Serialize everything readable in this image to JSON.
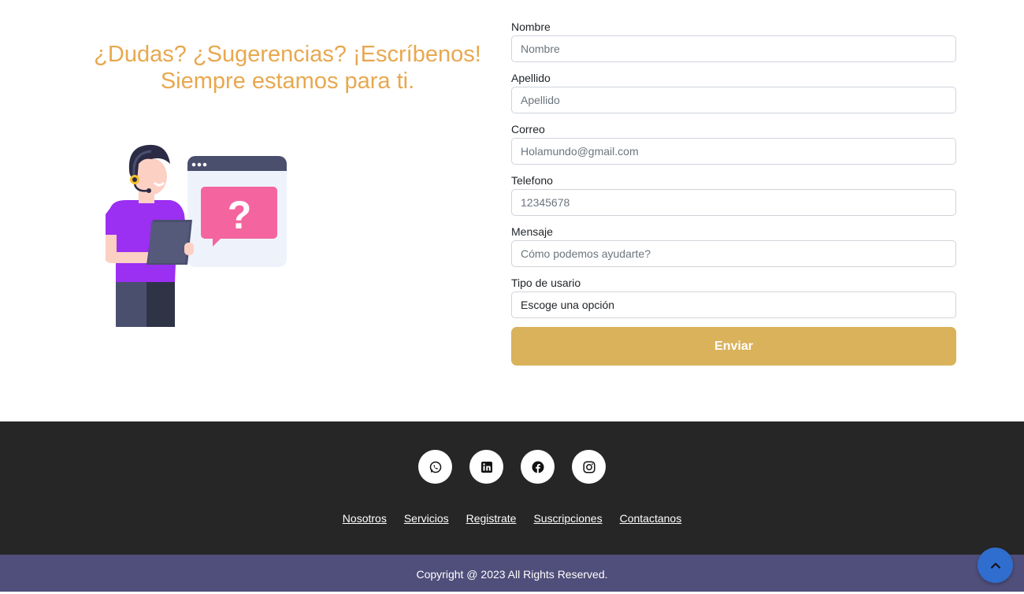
{
  "contact": {
    "heading_line1": "¿Dudas? ¿Sugerencias? ¡Escríbenos!",
    "heading_line2": "Siempre estamos para ti.",
    "illustration_icon": "support-agent-question-illustration"
  },
  "form": {
    "nombre": {
      "label": "Nombre",
      "placeholder": "Nombre"
    },
    "apellido": {
      "label": "Apellido",
      "placeholder": "Apellido"
    },
    "correo": {
      "label": "Correo",
      "placeholder": "Holamundo@gmail.com"
    },
    "telefono": {
      "label": "Telefono",
      "placeholder": "12345678"
    },
    "mensaje": {
      "label": "Mensaje",
      "placeholder": "Cómo podemos ayudarte?"
    },
    "tipo_usuario": {
      "label": "Tipo de usario",
      "selected": "Escoge una opción"
    },
    "submit_label": "Enviar"
  },
  "footer": {
    "socials": [
      "whatsapp-icon",
      "linkedin-icon",
      "facebook-icon",
      "instagram-icon"
    ],
    "links": [
      "Nosotros",
      "Servicios",
      "Registrate",
      "Suscripciones",
      "Contactanos"
    ],
    "copyright": "Copyright @ 2023 All Rights Reserved."
  },
  "colors": {
    "heading": "#e8a84f",
    "submit_button": "#d9b25b",
    "footer_bg": "#262626",
    "copyright_bg": "#504e7a",
    "scroll_top_button": "#2f6dce"
  }
}
